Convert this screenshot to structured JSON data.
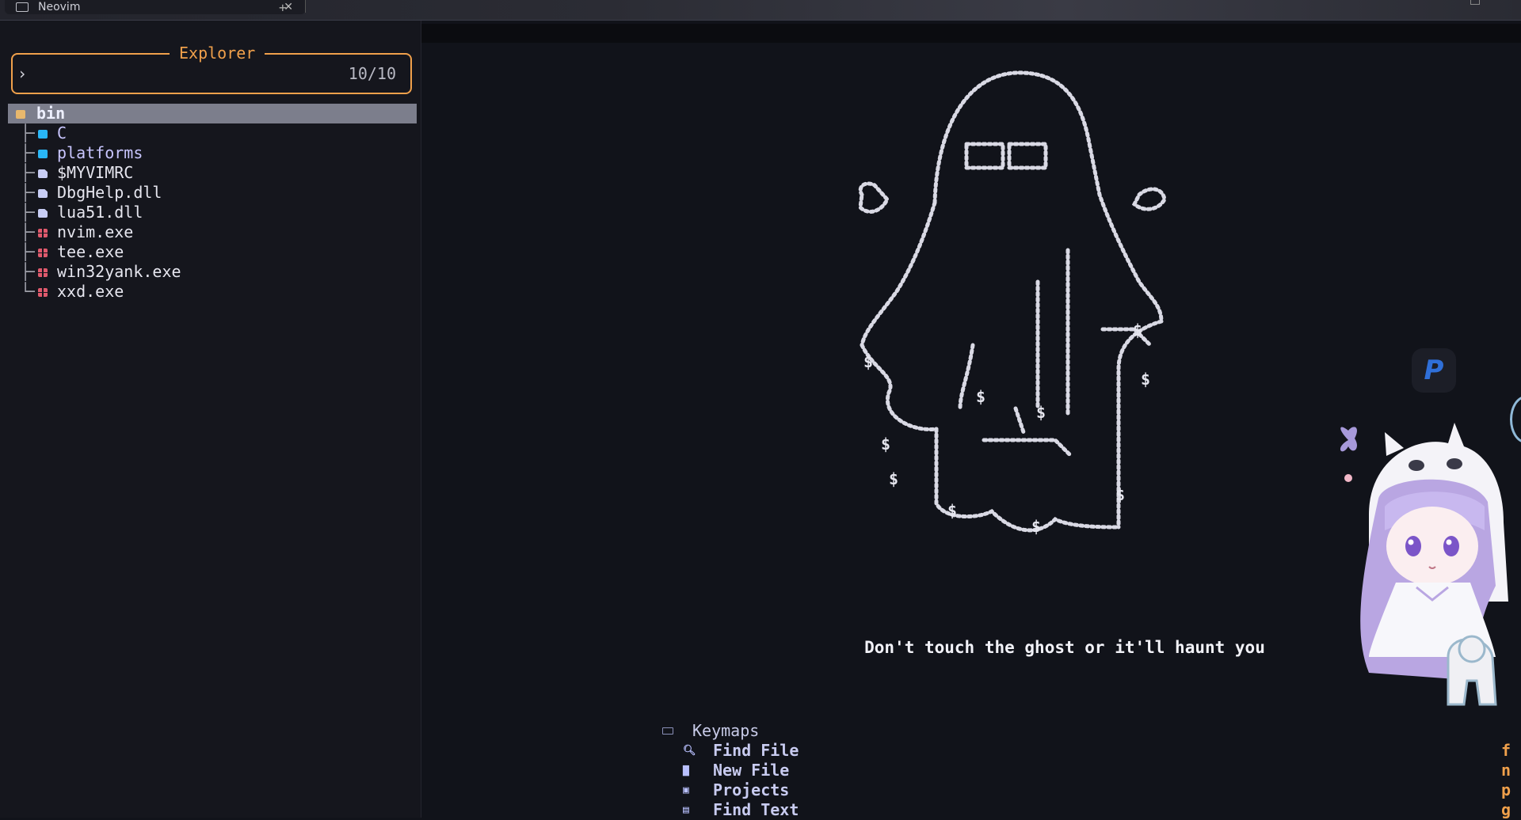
{
  "window": {
    "tab_title": "Neovim"
  },
  "explorer": {
    "title": "Explorer",
    "prompt": "›",
    "count": "10/10",
    "items": [
      {
        "name": "bin",
        "kind": "folder-open",
        "selected": true
      },
      {
        "name": "C",
        "kind": "folder"
      },
      {
        "name": "platforms",
        "kind": "folder"
      },
      {
        "name": "$MYVIMRC",
        "kind": "file"
      },
      {
        "name": "DbgHelp.dll",
        "kind": "file"
      },
      {
        "name": "lua51.dll",
        "kind": "file"
      },
      {
        "name": "nvim.exe",
        "kind": "exe"
      },
      {
        "name": "tee.exe",
        "kind": "exe"
      },
      {
        "name": "win32yank.exe",
        "kind": "exe"
      },
      {
        "name": "xxd.exe",
        "kind": "exe"
      }
    ]
  },
  "dashboard": {
    "tagline": "Don't touch the ghost or it'll haunt you",
    "keymaps_title": "Keymaps",
    "keymaps": [
      {
        "label": "Find File",
        "key": "f",
        "icon": "search-icon"
      },
      {
        "label": "New File",
        "key": "n",
        "icon": "file-icon"
      },
      {
        "label": "Projects",
        "key": "p",
        "icon": "projects-icon"
      },
      {
        "label": "Find Text",
        "key": "g",
        "icon": "text-search-icon"
      }
    ]
  },
  "badge": {
    "letter": "P"
  },
  "colors": {
    "accent": "#f0a04b",
    "background": "#11131a",
    "sidebar": "#15161d",
    "selection": "#7c7e8c"
  }
}
